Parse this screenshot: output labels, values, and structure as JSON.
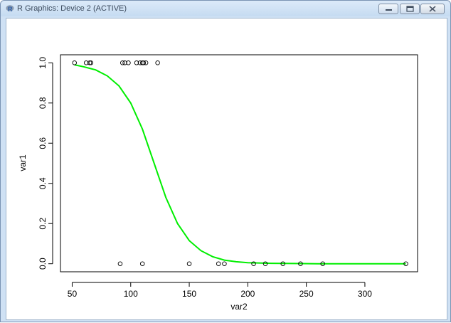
{
  "window": {
    "title": "R Graphics: Device 2 (ACTIVE)",
    "icons": [
      "r-app-icon",
      "minimize-icon",
      "maximize-icon",
      "close-icon"
    ]
  },
  "chart_data": {
    "type": "scatter",
    "title": "",
    "xlabel": "var2",
    "ylabel": "var1",
    "xlim": [
      40,
      345
    ],
    "ylim": [
      -0.04,
      1.04
    ],
    "x_ticks": [
      50,
      100,
      150,
      200,
      250,
      300
    ],
    "y_ticks": [
      0.0,
      0.2,
      0.4,
      0.6,
      0.8,
      1.0
    ],
    "x_tick_labels": [
      "50",
      "100",
      "150",
      "200",
      "250",
      "300"
    ],
    "y_tick_labels": [
      "0.0",
      "0.2",
      "0.4",
      "0.6",
      "0.8",
      "1.0"
    ],
    "grid": false,
    "points": {
      "marker": "open-circle",
      "color": "#000000",
      "x": [
        52,
        62,
        65,
        66,
        93,
        95,
        98,
        105,
        108,
        110,
        111,
        113,
        123,
        91,
        110,
        150,
        175,
        180,
        205,
        215,
        230,
        245,
        264,
        335
      ],
      "y": [
        1,
        1,
        1,
        1,
        1,
        1,
        1,
        1,
        1,
        1,
        1,
        1,
        1,
        0,
        0,
        0,
        0,
        0,
        0,
        0,
        0,
        0,
        0,
        0
      ]
    },
    "fitted_curve": {
      "color": "#00ee00",
      "x": [
        52,
        60,
        70,
        80,
        90,
        100,
        110,
        120,
        130,
        140,
        150,
        160,
        170,
        180,
        190,
        200,
        220,
        240,
        260,
        280,
        300,
        335
      ],
      "y": [
        0.99,
        0.98,
        0.965,
        0.935,
        0.885,
        0.8,
        0.67,
        0.5,
        0.33,
        0.2,
        0.115,
        0.065,
        0.035,
        0.018,
        0.01,
        0.005,
        0.002,
        0.001,
        0.0,
        0.0,
        0.0,
        0.0
      ]
    }
  }
}
